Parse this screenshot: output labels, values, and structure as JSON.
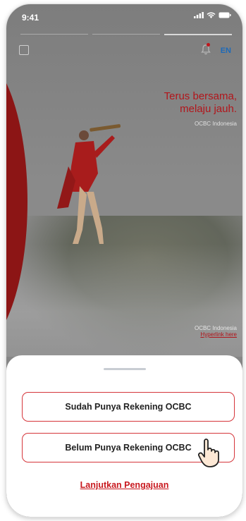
{
  "status_bar": {
    "time": "9:41"
  },
  "header": {
    "language": "EN"
  },
  "hero": {
    "tagline_line1": "Terus bersama,",
    "tagline_line2": "melaju jauh.",
    "tagline_brand": "OCBC Indonesia",
    "credit_name": "OCBC Indonesia",
    "credit_link": "Hyperlink here"
  },
  "sheet": {
    "button_existing_account": "Sudah Punya Rekening OCBC",
    "button_new_account": "Belum Punya Rekening OCBC",
    "continue_link": "Lanjutkan Pengajuan"
  },
  "colors": {
    "brand_red": "#c8181e",
    "dark_red": "#8c1515",
    "link_blue": "#1e6ab8"
  }
}
